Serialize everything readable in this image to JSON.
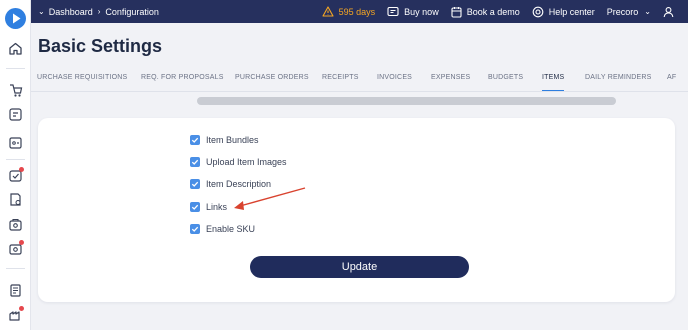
{
  "topbar": {
    "breadcrumb": [
      "Dashboard",
      "Configuration"
    ],
    "trial": "595 days",
    "buy_now": "Buy now",
    "book_demo": "Book a demo",
    "help_center": "Help center",
    "company": "Precoro"
  },
  "page": {
    "title": "Basic Settings"
  },
  "tabs": [
    {
      "label": "URCHASE REQUISITIONS"
    },
    {
      "label": "REQ. FOR PROPOSALS"
    },
    {
      "label": "PURCHASE ORDERS"
    },
    {
      "label": "RECEIPTS"
    },
    {
      "label": "INVOICES"
    },
    {
      "label": "EXPENSES"
    },
    {
      "label": "BUDGETS"
    },
    {
      "label": "ITEMS"
    },
    {
      "label": "DAILY REMINDERS"
    },
    {
      "label": "AF"
    }
  ],
  "active_tab": "ITEMS",
  "settings": {
    "options": [
      {
        "label": "Item Bundles",
        "checked": true
      },
      {
        "label": "Upload Item Images",
        "checked": true
      },
      {
        "label": "Item Description",
        "checked": true
      },
      {
        "label": "Links",
        "checked": true
      },
      {
        "label": "Enable SKU",
        "checked": true
      }
    ],
    "update_label": "Update"
  },
  "colors": {
    "topbar": "#26305e",
    "accent": "#2f7fe0",
    "checkbox": "#4a8fe6",
    "button": "#202c5c",
    "trial": "#f5a623",
    "annotation_arrow": "#d9432f"
  },
  "icons": {
    "sidebar": [
      "home-icon",
      "requisition-icon",
      "proposal-icon",
      "orders-icon",
      "receipts-icon",
      "invoices-icon",
      "expenses-icon",
      "budgets-icon",
      "catalog-icon",
      "suppliers-icon"
    ],
    "topbar": [
      "warning-icon",
      "cart-icon",
      "calendar-icon",
      "help-icon",
      "user-icon"
    ]
  }
}
